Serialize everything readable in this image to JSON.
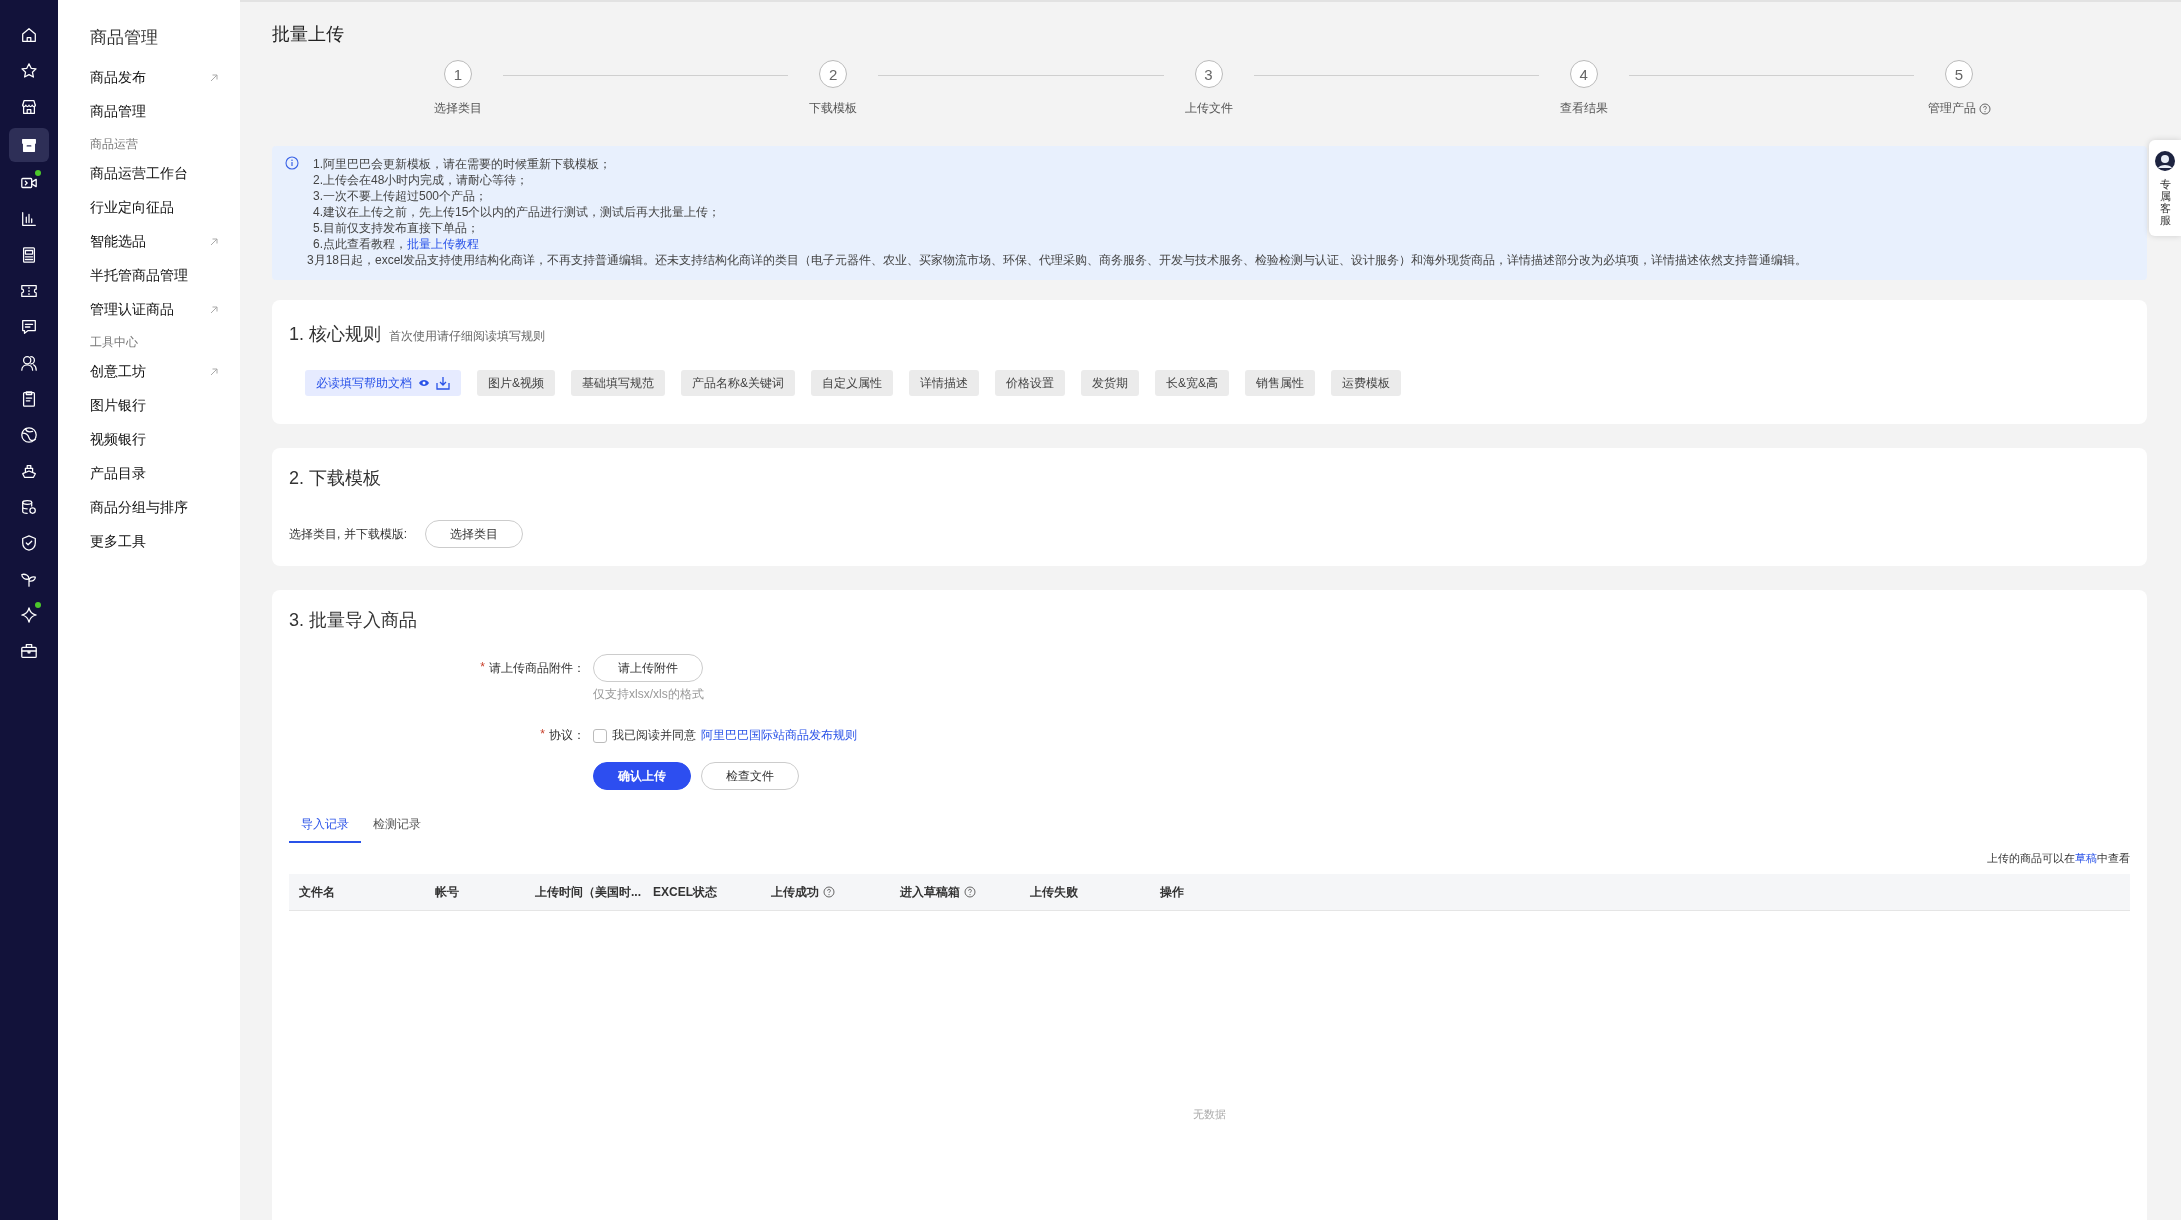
{
  "rail": [
    {
      "selected": false,
      "dot": false
    },
    {
      "selected": false,
      "dot": false
    },
    {
      "selected": false,
      "dot": false
    },
    {
      "selected": true,
      "dot": false
    },
    {
      "selected": false,
      "dot": true
    },
    {
      "selected": false,
      "dot": false
    },
    {
      "selected": false,
      "dot": false
    },
    {
      "selected": false,
      "dot": false
    },
    {
      "selected": false,
      "dot": false
    },
    {
      "selected": false,
      "dot": false
    },
    {
      "selected": false,
      "dot": false
    },
    {
      "selected": false,
      "dot": false
    },
    {
      "selected": false,
      "dot": false
    },
    {
      "selected": false,
      "dot": false
    },
    {
      "selected": false,
      "dot": false
    },
    {
      "selected": false,
      "dot": false
    },
    {
      "selected": false,
      "dot": true
    },
    {
      "selected": false,
      "dot": false
    }
  ],
  "sidebar": {
    "title": "商品管理",
    "items": [
      {
        "kind": "item",
        "label": "商品发布",
        "external": true
      },
      {
        "kind": "item",
        "label": "商品管理",
        "external": false
      },
      {
        "kind": "section",
        "label": "商品运营"
      },
      {
        "kind": "item",
        "label": "商品运营工作台",
        "external": false
      },
      {
        "kind": "item",
        "label": "行业定向征品",
        "external": false
      },
      {
        "kind": "item",
        "label": "智能选品",
        "external": true
      },
      {
        "kind": "item",
        "label": "半托管商品管理",
        "external": false
      },
      {
        "kind": "item",
        "label": "管理认证商品",
        "external": true
      },
      {
        "kind": "section",
        "label": "工具中心"
      },
      {
        "kind": "item",
        "label": "创意工坊",
        "external": true
      },
      {
        "kind": "item",
        "label": "图片银行",
        "external": false
      },
      {
        "kind": "item",
        "label": "视频银行",
        "external": false
      },
      {
        "kind": "item",
        "label": "产品目录",
        "external": false
      },
      {
        "kind": "item",
        "label": "商品分组与排序",
        "external": false
      },
      {
        "kind": "item",
        "label": "更多工具",
        "external": false
      }
    ]
  },
  "page_title": "批量上传",
  "steps": [
    {
      "number": "1",
      "label": "选择类目",
      "help": false
    },
    {
      "number": "2",
      "label": "下载模板",
      "help": false
    },
    {
      "number": "3",
      "label": "上传文件",
      "help": false
    },
    {
      "number": "4",
      "label": "查看结果",
      "help": false
    },
    {
      "number": "5",
      "label": "管理产品",
      "help": true
    }
  ],
  "notice": {
    "lines": [
      {
        "text": "1.阿里巴巴会更新模板，请在需要的时候重新下载模板；"
      },
      {
        "text": "2.上传会在48小时内完成，请耐心等待；"
      },
      {
        "text": "3.一次不要上传超过500个产品；"
      },
      {
        "text": "4.建议在上传之前，先上传15个以内的产品进行测试，测试后再大批量上传；"
      },
      {
        "text": "5.目前仅支持发布直接下单品；"
      },
      {
        "text": "6.点此查看教程，",
        "link": "批量上传教程"
      },
      {
        "text": "3月18日起，excel发品支持使用结构化商详，不再支持普通编辑。还未支持结构化商详的类目（电子元器件、农业、买家物流市场、环保、代理采购、商务服务、开发与技术服务、检验检测与认证、设计服务）和海外现货商品，详情描述部分改为必填项，详情描述依然支持普通编辑。"
      }
    ]
  },
  "rules": {
    "title": "1. 核心规则",
    "subtitle": "首次使用请仔细阅读填写规则",
    "tags": [
      {
        "kind": "primary",
        "label": "必读填写帮助文档"
      },
      {
        "kind": "plain",
        "label": "图片&视频"
      },
      {
        "kind": "plain",
        "label": "基础填写规范"
      },
      {
        "kind": "plain",
        "label": "产品名称&关键词"
      },
      {
        "kind": "plain",
        "label": "自定义属性"
      },
      {
        "kind": "plain",
        "label": "详情描述"
      },
      {
        "kind": "plain",
        "label": "价格设置"
      },
      {
        "kind": "plain",
        "label": "发货期"
      },
      {
        "kind": "plain",
        "label": "长&宽&高"
      },
      {
        "kind": "plain",
        "label": "销售属性"
      },
      {
        "kind": "plain",
        "label": "运费模板"
      }
    ]
  },
  "download": {
    "title": "2. 下载模板",
    "label": "选择类目, 并下载模版:",
    "button": "选择类目"
  },
  "import": {
    "title": "3. 批量导入商品",
    "attachment": {
      "required_mark": "*",
      "label": "请上传商品附件：",
      "button": "请上传附件",
      "hint": "仅支持xlsx/xls的格式"
    },
    "agreement": {
      "required_mark": "*",
      "label": "协议：",
      "checked": false,
      "text": "我已阅读并同意",
      "link": "阿里巴巴国际站商品发布规则"
    },
    "buttons": [
      {
        "kind": "primary",
        "label": "确认上传"
      },
      {
        "kind": "plain",
        "label": "检查文件"
      }
    ],
    "tabs": [
      {
        "label": "导入记录",
        "selected": true
      },
      {
        "label": "检测记录",
        "selected": false
      }
    ],
    "note": {
      "before": "上传的商品可以在",
      "link": "草稿",
      "after": "中查看"
    },
    "table": {
      "columns": [
        {
          "label": "文件名",
          "help": false
        },
        {
          "label": "帐号",
          "help": false
        },
        {
          "label": "上传时间（美国时...",
          "help": false
        },
        {
          "label": "EXCEL状态",
          "help": false
        },
        {
          "label": "上传成功",
          "help": true
        },
        {
          "label": "进入草稿箱",
          "help": true
        },
        {
          "label": "上传失败",
          "help": false
        },
        {
          "label": "操作",
          "help": false
        }
      ],
      "empty": "无数据"
    }
  },
  "service": {
    "label": "专属客服"
  }
}
